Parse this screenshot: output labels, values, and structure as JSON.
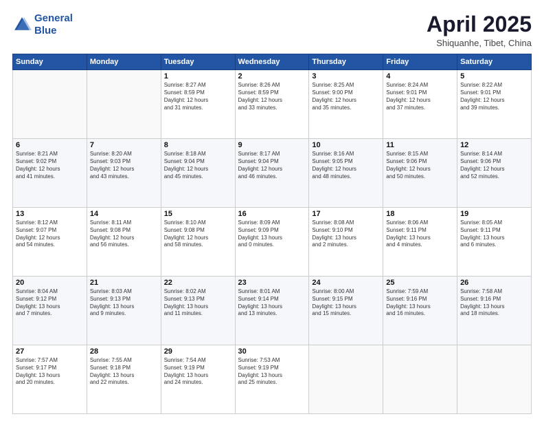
{
  "logo": {
    "line1": "General",
    "line2": "Blue"
  },
  "title": {
    "main": "April 2025",
    "sub": "Shiquanhe, Tibet, China"
  },
  "weekdays": [
    "Sunday",
    "Monday",
    "Tuesday",
    "Wednesday",
    "Thursday",
    "Friday",
    "Saturday"
  ],
  "weeks": [
    [
      {
        "day": "",
        "info": ""
      },
      {
        "day": "",
        "info": ""
      },
      {
        "day": "1",
        "info": "Sunrise: 8:27 AM\nSunset: 8:59 PM\nDaylight: 12 hours\nand 31 minutes."
      },
      {
        "day": "2",
        "info": "Sunrise: 8:26 AM\nSunset: 8:59 PM\nDaylight: 12 hours\nand 33 minutes."
      },
      {
        "day": "3",
        "info": "Sunrise: 8:25 AM\nSunset: 9:00 PM\nDaylight: 12 hours\nand 35 minutes."
      },
      {
        "day": "4",
        "info": "Sunrise: 8:24 AM\nSunset: 9:01 PM\nDaylight: 12 hours\nand 37 minutes."
      },
      {
        "day": "5",
        "info": "Sunrise: 8:22 AM\nSunset: 9:01 PM\nDaylight: 12 hours\nand 39 minutes."
      }
    ],
    [
      {
        "day": "6",
        "info": "Sunrise: 8:21 AM\nSunset: 9:02 PM\nDaylight: 12 hours\nand 41 minutes."
      },
      {
        "day": "7",
        "info": "Sunrise: 8:20 AM\nSunset: 9:03 PM\nDaylight: 12 hours\nand 43 minutes."
      },
      {
        "day": "8",
        "info": "Sunrise: 8:18 AM\nSunset: 9:04 PM\nDaylight: 12 hours\nand 45 minutes."
      },
      {
        "day": "9",
        "info": "Sunrise: 8:17 AM\nSunset: 9:04 PM\nDaylight: 12 hours\nand 46 minutes."
      },
      {
        "day": "10",
        "info": "Sunrise: 8:16 AM\nSunset: 9:05 PM\nDaylight: 12 hours\nand 48 minutes."
      },
      {
        "day": "11",
        "info": "Sunrise: 8:15 AM\nSunset: 9:06 PM\nDaylight: 12 hours\nand 50 minutes."
      },
      {
        "day": "12",
        "info": "Sunrise: 8:14 AM\nSunset: 9:06 PM\nDaylight: 12 hours\nand 52 minutes."
      }
    ],
    [
      {
        "day": "13",
        "info": "Sunrise: 8:12 AM\nSunset: 9:07 PM\nDaylight: 12 hours\nand 54 minutes."
      },
      {
        "day": "14",
        "info": "Sunrise: 8:11 AM\nSunset: 9:08 PM\nDaylight: 12 hours\nand 56 minutes."
      },
      {
        "day": "15",
        "info": "Sunrise: 8:10 AM\nSunset: 9:08 PM\nDaylight: 12 hours\nand 58 minutes."
      },
      {
        "day": "16",
        "info": "Sunrise: 8:09 AM\nSunset: 9:09 PM\nDaylight: 13 hours\nand 0 minutes."
      },
      {
        "day": "17",
        "info": "Sunrise: 8:08 AM\nSunset: 9:10 PM\nDaylight: 13 hours\nand 2 minutes."
      },
      {
        "day": "18",
        "info": "Sunrise: 8:06 AM\nSunset: 9:11 PM\nDaylight: 13 hours\nand 4 minutes."
      },
      {
        "day": "19",
        "info": "Sunrise: 8:05 AM\nSunset: 9:11 PM\nDaylight: 13 hours\nand 6 minutes."
      }
    ],
    [
      {
        "day": "20",
        "info": "Sunrise: 8:04 AM\nSunset: 9:12 PM\nDaylight: 13 hours\nand 7 minutes."
      },
      {
        "day": "21",
        "info": "Sunrise: 8:03 AM\nSunset: 9:13 PM\nDaylight: 13 hours\nand 9 minutes."
      },
      {
        "day": "22",
        "info": "Sunrise: 8:02 AM\nSunset: 9:13 PM\nDaylight: 13 hours\nand 11 minutes."
      },
      {
        "day": "23",
        "info": "Sunrise: 8:01 AM\nSunset: 9:14 PM\nDaylight: 13 hours\nand 13 minutes."
      },
      {
        "day": "24",
        "info": "Sunrise: 8:00 AM\nSunset: 9:15 PM\nDaylight: 13 hours\nand 15 minutes."
      },
      {
        "day": "25",
        "info": "Sunrise: 7:59 AM\nSunset: 9:16 PM\nDaylight: 13 hours\nand 16 minutes."
      },
      {
        "day": "26",
        "info": "Sunrise: 7:58 AM\nSunset: 9:16 PM\nDaylight: 13 hours\nand 18 minutes."
      }
    ],
    [
      {
        "day": "27",
        "info": "Sunrise: 7:57 AM\nSunset: 9:17 PM\nDaylight: 13 hours\nand 20 minutes."
      },
      {
        "day": "28",
        "info": "Sunrise: 7:55 AM\nSunset: 9:18 PM\nDaylight: 13 hours\nand 22 minutes."
      },
      {
        "day": "29",
        "info": "Sunrise: 7:54 AM\nSunset: 9:19 PM\nDaylight: 13 hours\nand 24 minutes."
      },
      {
        "day": "30",
        "info": "Sunrise: 7:53 AM\nSunset: 9:19 PM\nDaylight: 13 hours\nand 25 minutes."
      },
      {
        "day": "",
        "info": ""
      },
      {
        "day": "",
        "info": ""
      },
      {
        "day": "",
        "info": ""
      }
    ]
  ]
}
